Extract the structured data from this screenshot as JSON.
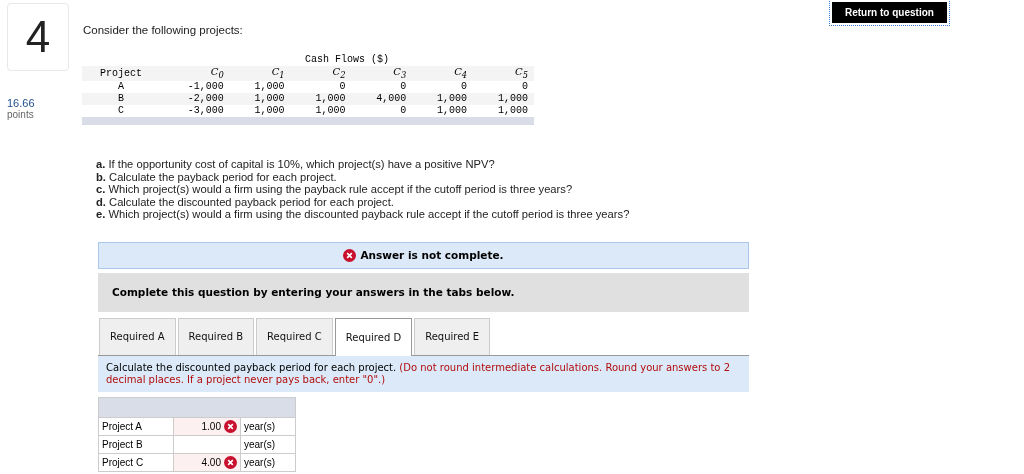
{
  "question": {
    "number": "4",
    "points": "16.66",
    "points_label": "points",
    "intro": "Consider the following projects:"
  },
  "return_button": "Return to question",
  "cash_table": {
    "group_heading": "Cash Flows ($)",
    "columns": [
      "Project",
      "C$_{0}$",
      "C$_{1}$",
      "C$_{2}$",
      "C$_{3}$",
      "C$_{4}$",
      "C$_{5}$"
    ],
    "rows": [
      [
        "A",
        "-1,000",
        "1,000",
        "0",
        "0",
        "0",
        "0"
      ],
      [
        "B",
        "-2,000",
        "1,000",
        "1,000",
        "4,000",
        "1,000",
        "1,000"
      ],
      [
        "C",
        "-3,000",
        "1,000",
        "1,000",
        "0",
        "1,000",
        "1,000"
      ]
    ]
  },
  "parts": [
    {
      "letter": "a.",
      "text": "If the opportunity cost of capital is 10%, which project(s) have a positive NPV?"
    },
    {
      "letter": "b.",
      "text": "Calculate the payback period for each project."
    },
    {
      "letter": "c.",
      "text": "Which project(s) would a firm using the payback rule accept if the cutoff period is three years?"
    },
    {
      "letter": "d.",
      "text": "Calculate the discounted payback period for each project."
    },
    {
      "letter": "e.",
      "text": "Which project(s) would a firm using the discounted payback rule accept if the cutoff period is three years?"
    }
  ],
  "status_banner": "Answer is not complete.",
  "instruction_banner": "Complete this question by entering your answers in the tabs below.",
  "tabs": [
    {
      "label": "Required A",
      "selected": false
    },
    {
      "label": "Required B",
      "selected": false
    },
    {
      "label": "Required C",
      "selected": false
    },
    {
      "label": "Required D",
      "selected": true
    },
    {
      "label": "Required E",
      "selected": false
    }
  ],
  "task": {
    "text": "Calculate the discounted payback period for each project.",
    "note": "(Do not round intermediate calculations. Round your answers to 2 decimal places. If a project never pays back, enter \"0\".)"
  },
  "answers": [
    {
      "label": "Project A",
      "value": "1.00",
      "incorrect": true,
      "unit": "year(s)"
    },
    {
      "label": "Project B",
      "incorrect": false,
      "unit": "year(s)"
    },
    {
      "label": "Project C",
      "value": "4.00",
      "incorrect": true,
      "unit": "year(s)"
    }
  ]
}
